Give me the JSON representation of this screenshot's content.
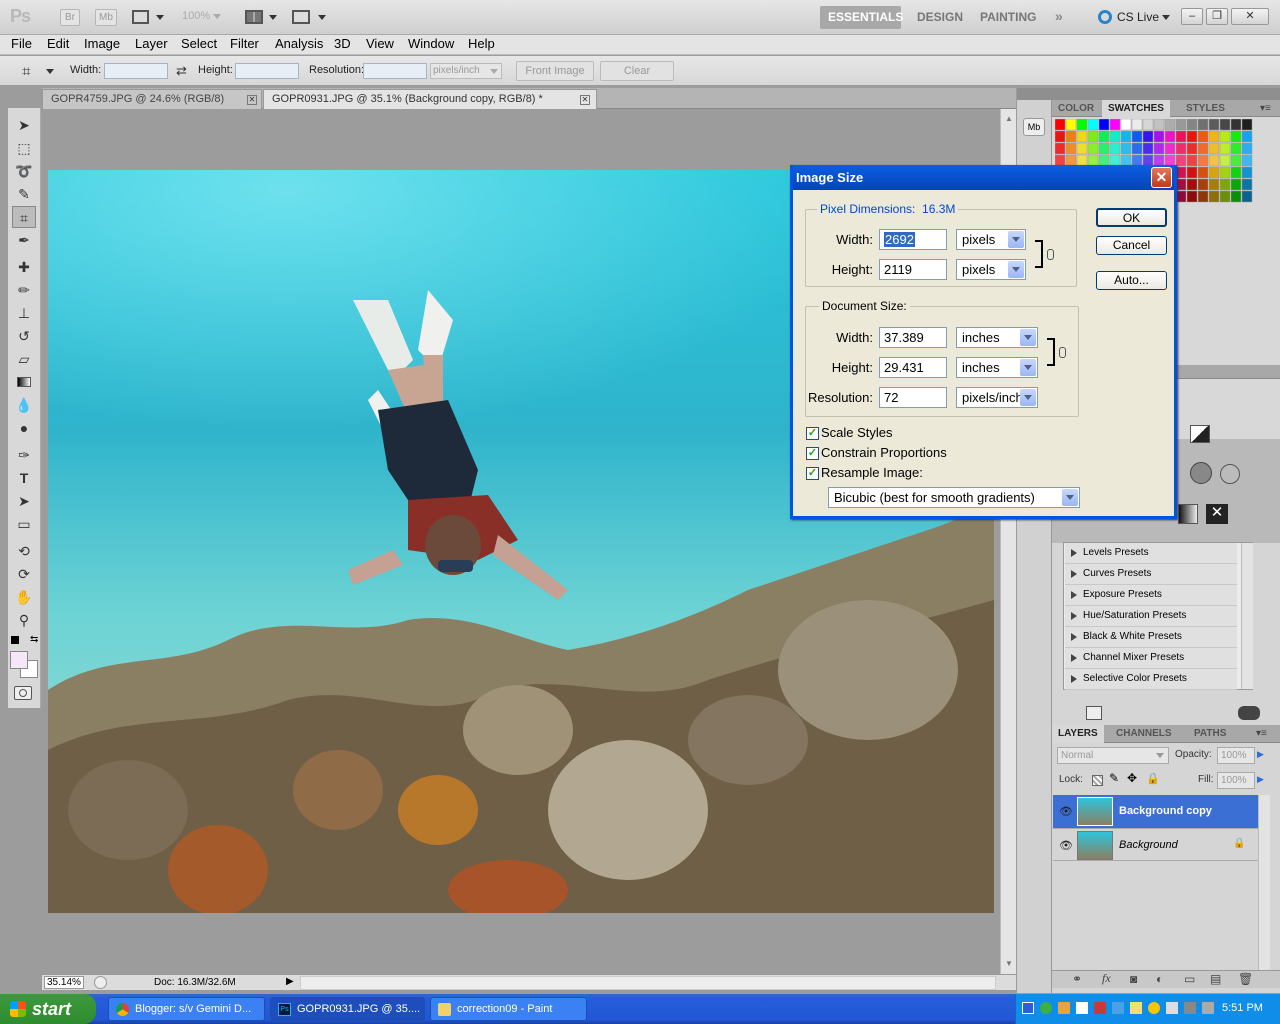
{
  "app": {
    "logo": "Ps",
    "bridge": "Br",
    "minibridge": "Mb",
    "zoom": "100%",
    "workspaces": [
      "ESSENTIALS",
      "DESIGN",
      "PAINTING"
    ],
    "cslive": "CS Live"
  },
  "menu": [
    "File",
    "Edit",
    "Image",
    "Layer",
    "Select",
    "Filter",
    "Analysis",
    "3D",
    "View",
    "Window",
    "Help"
  ],
  "options": {
    "width_label": "Width:",
    "height_label": "Height:",
    "resolution_label": "Resolution:",
    "units": "pixels/inch",
    "front_image": "Front Image",
    "clear": "Clear"
  },
  "tabs": [
    {
      "label": "GOPR4759.JPG @ 24.6% (RGB/8)"
    },
    {
      "label": "GOPR0931.JPG @ 35.1% (Background copy, RGB/8) *"
    }
  ],
  "status": {
    "zoom": "35.14%",
    "doc": "Doc: 16.3M/32.6M"
  },
  "panels": {
    "color_tabs": [
      "COLOR",
      "SWATCHES",
      "STYLES"
    ],
    "presets": [
      "Levels Presets",
      "Curves Presets",
      "Exposure Presets",
      "Hue/Saturation Presets",
      "Black & White Presets",
      "Channel Mixer Presets",
      "Selective Color Presets"
    ],
    "layer_tabs": [
      "LAYERS",
      "CHANNELS",
      "PATHS"
    ],
    "blend_mode": "Normal",
    "opacity_label": "Opacity:",
    "opacity": "100%",
    "lock_label": "Lock:",
    "fill_label": "Fill:",
    "fill": "100%",
    "layers": [
      "Background copy",
      "Background"
    ]
  },
  "dialog": {
    "title": "Image Size",
    "pixel_dim_label": "Pixel Dimensions:",
    "pixel_dim_value": "16.3M",
    "width_label": "Width:",
    "height_label": "Height:",
    "px_width": "2692",
    "px_height": "2119",
    "px_unit": "pixels",
    "doc_size_label": "Document Size:",
    "doc_width": "37.389",
    "doc_height": "29.431",
    "doc_unit": "inches",
    "resolution_label": "Resolution:",
    "resolution": "72",
    "res_unit": "pixels/inch",
    "scale_styles": "Scale Styles",
    "constrain": "Constrain Proportions",
    "resample": "Resample Image:",
    "method": "Bicubic (best for smooth gradients)",
    "ok": "OK",
    "cancel": "Cancel",
    "auto": "Auto..."
  },
  "taskbar": {
    "start": "start",
    "items": [
      "Blogger: s/v Gemini D...",
      "GOPR0931.JPG @ 35....",
      "correction09 - Paint"
    ],
    "time": "5:51 PM"
  },
  "colors": {
    "accent": "#0054e3",
    "layer_selected": "#3b6fd4"
  }
}
